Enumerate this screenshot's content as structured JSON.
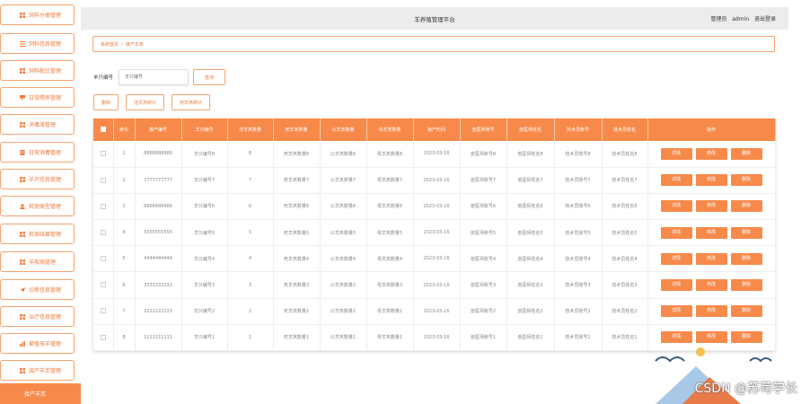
{
  "app": {
    "title": "羊养殖管理平台",
    "user_role": "管理员",
    "username": "admin",
    "logout": "退出登录"
  },
  "sidebar": {
    "items": [
      {
        "label": "饲料分类管理",
        "icon": "grid-icon"
      },
      {
        "label": "饲料信息管理",
        "icon": "list-icon"
      },
      {
        "label": "饲料配比管理",
        "icon": "grid-icon"
      },
      {
        "label": "日常喂养管理",
        "icon": "feed-icon"
      },
      {
        "label": "消毒液管理",
        "icon": "grid-icon"
      },
      {
        "label": "日常消毒管理",
        "icon": "doc-icon"
      },
      {
        "label": "羊只信息管理",
        "icon": "grid-icon"
      },
      {
        "label": "检测类型管理",
        "icon": "user-icon"
      },
      {
        "label": "检测结果管理",
        "icon": "grid-icon"
      },
      {
        "label": "羊疾病管理",
        "icon": "grid-icon"
      },
      {
        "label": "诊断信息管理",
        "icon": "plane-icon"
      },
      {
        "label": "治疗信息管理",
        "icon": "grid-icon"
      },
      {
        "label": "繁殖母羊管理",
        "icon": "chart-icon"
      },
      {
        "label": "接产羊羔管理",
        "icon": "grid-icon"
      },
      {
        "label": "接产羊羔",
        "icon": "",
        "active": true
      }
    ]
  },
  "breadcrumb": {
    "home": "系统首页",
    "separator": "/",
    "current": "接产羊羔"
  },
  "search": {
    "label": "羊只编号",
    "placeholder": "羊只编号",
    "button": "查询"
  },
  "actions": {
    "delete": "删除",
    "stat1": "活羊羔统计",
    "stat2": "死羊羔统计"
  },
  "table": {
    "headers": [
      "索引",
      "接产编号",
      "羊只编号",
      "活羊羔数量",
      "死羊羔数量",
      "公羊羔数量",
      "母羊羔数量",
      "接产时间",
      "兽医师账号",
      "兽医师姓名",
      "技术员账号",
      "技术员姓名",
      "操作"
    ],
    "buttons": {
      "detail": "详情",
      "edit": "修改",
      "delete": "删除"
    },
    "rows": [
      {
        "index": "1",
        "code": "8888888888",
        "sheep": "羊只编号8",
        "live": "8",
        "dead": "死羊羔数量8",
        "male": "公羊羔数量8",
        "female": "母羊羔数量8",
        "date": "2023-03-16",
        "vet_acc": "兽医师账号8",
        "vet_name": "兽医师姓名8",
        "tech_acc": "技术员账号8",
        "tech_name": "技术员姓名8"
      },
      {
        "index": "2",
        "code": "7777777777",
        "sheep": "羊只编号7",
        "live": "7",
        "dead": "死羊羔数量7",
        "male": "公羊羔数量7",
        "female": "母羊羔数量7",
        "date": "2023-03-16",
        "vet_acc": "兽医师账号7",
        "vet_name": "兽医师姓名7",
        "tech_acc": "技术员账号7",
        "tech_name": "技术员姓名7"
      },
      {
        "index": "3",
        "code": "6666666666",
        "sheep": "羊只编号6",
        "live": "6",
        "dead": "死羊羔数量6",
        "male": "公羊羔数量6",
        "female": "母羊羔数量6",
        "date": "2023-03-16",
        "vet_acc": "兽医师账号6",
        "vet_name": "兽医师姓名6",
        "tech_acc": "技术员账号6",
        "tech_name": "技术员姓名6"
      },
      {
        "index": "4",
        "code": "5555555555",
        "sheep": "羊只编号5",
        "live": "5",
        "dead": "死羊羔数量5",
        "male": "公羊羔数量5",
        "female": "母羊羔数量5",
        "date": "2023-03-16",
        "vet_acc": "兽医师账号5",
        "vet_name": "兽医师姓名5",
        "tech_acc": "技术员账号5",
        "tech_name": "技术员姓名5"
      },
      {
        "index": "5",
        "code": "4444444444",
        "sheep": "羊只编号4",
        "live": "4",
        "dead": "死羊羔数量4",
        "male": "公羊羔数量4",
        "female": "母羊羔数量4",
        "date": "2023-03-16",
        "vet_acc": "兽医师账号4",
        "vet_name": "兽医师姓名4",
        "tech_acc": "技术员账号4",
        "tech_name": "技术员姓名4"
      },
      {
        "index": "6",
        "code": "3333333333",
        "sheep": "羊只编号3",
        "live": "3",
        "dead": "死羊羔数量3",
        "male": "公羊羔数量3",
        "female": "母羊羔数量3",
        "date": "2023-03-16",
        "vet_acc": "兽医师账号3",
        "vet_name": "兽医师姓名3",
        "tech_acc": "技术员账号3",
        "tech_name": "技术员姓名3"
      },
      {
        "index": "7",
        "code": "2222222222",
        "sheep": "羊只编号2",
        "live": "2",
        "dead": "死羊羔数量2",
        "male": "公羊羔数量2",
        "female": "母羊羔数量2",
        "date": "2023-03-16",
        "vet_acc": "兽医师账号2",
        "vet_name": "兽医师姓名2",
        "tech_acc": "技术员账号2",
        "tech_name": "技术员姓名2"
      },
      {
        "index": "8",
        "code": "1111111111",
        "sheep": "羊只编号1",
        "live": "1",
        "dead": "死羊羔数量1",
        "male": "公羊羔数量1",
        "female": "母羊羔数量1",
        "date": "2023-03-16",
        "vet_acc": "兽医师账号1",
        "vet_name": "兽医师姓名1",
        "tech_acc": "技术员账号1",
        "tech_name": "技术员姓名1"
      }
    ]
  },
  "watermark": {
    "text": "CSDN @苏苟学长"
  },
  "colors": {
    "accent": "#f78a4b",
    "accent_border": "#f4a36f",
    "accent_text": "#f07a3a",
    "topbar": "#ececec"
  }
}
